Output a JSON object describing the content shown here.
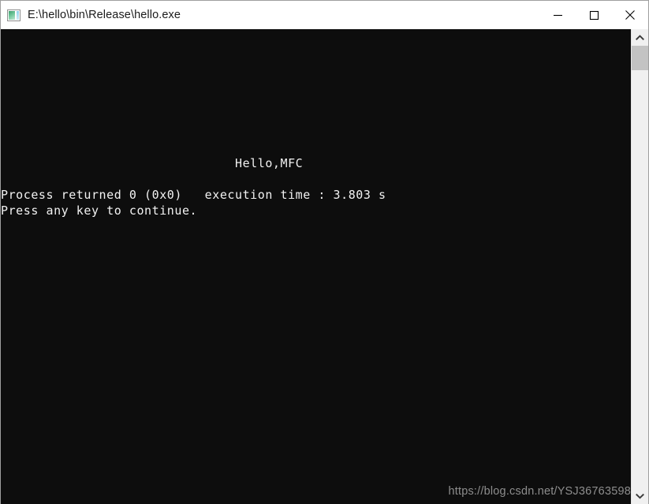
{
  "window": {
    "title": "E:\\hello\\bin\\Release\\hello.exe",
    "icon": "console-window-icon",
    "background_color": "#0d0d0d",
    "text_color": "#f2f2f2",
    "titlebar_color": "#ffffff"
  },
  "titlebar_buttons": {
    "minimize": "minimize-icon",
    "maximize": "maximize-icon",
    "close": "close-icon"
  },
  "console": {
    "lines": [
      "",
      "",
      "",
      "",
      "",
      "",
      "",
      "",
      "                               Hello,MFC",
      "",
      "Process returned 0 (0x0)   execution time : 3.803 s",
      "Press any key to continue."
    ],
    "program_output": "Hello,MFC",
    "exit_message": "Process returned 0 (0x0)   execution time : 3.803 s",
    "prompt": "Press any key to continue.",
    "return_code": "0",
    "return_code_hex": "0x0",
    "execution_time": "3.803 s"
  },
  "scrollbar": {
    "up_arrow": "chevron-up-icon",
    "down_arrow": "chevron-down-icon"
  },
  "watermark": {
    "text": "https://blog.csdn.net/YSJ36763598"
  }
}
